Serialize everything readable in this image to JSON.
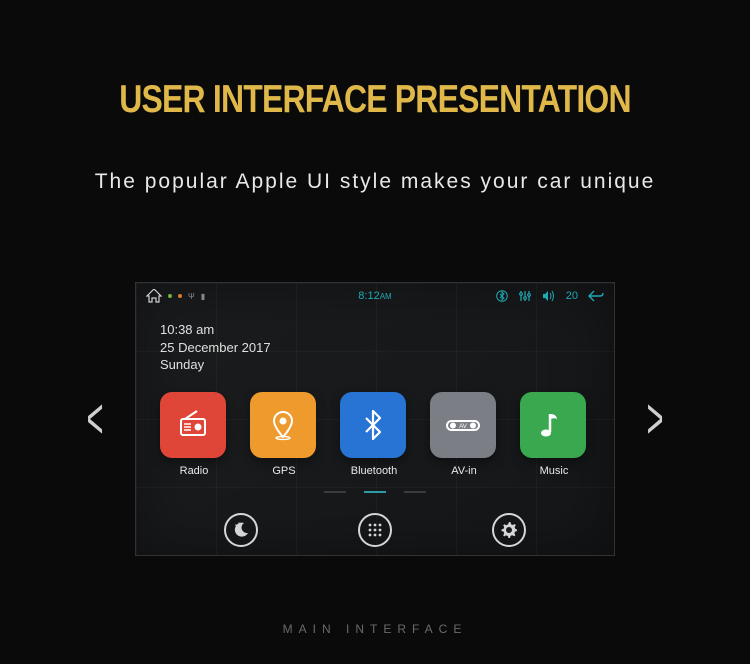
{
  "title": "USER INTERFACE PRESENTATION",
  "subtitle": "The popular Apple UI style makes your car unique",
  "footer": "MAIN INTERFACE",
  "arrows": {
    "prev": "<",
    "next": ">"
  },
  "status": {
    "time": "8:12",
    "ampm": "AM",
    "volume": "20"
  },
  "datetime": {
    "time": "10:38 am",
    "date": "25 December 2017",
    "day": "Sunday"
  },
  "apps": [
    {
      "label": "Radio",
      "color": "c-red",
      "icon": "radio-icon"
    },
    {
      "label": "GPS",
      "color": "c-org",
      "icon": "pin-icon"
    },
    {
      "label": "Bluetooth",
      "color": "c-blu",
      "icon": "bluetooth-icon"
    },
    {
      "label": "AV-in",
      "color": "c-gry",
      "icon": "avin-icon"
    },
    {
      "label": "Music",
      "color": "c-grn",
      "icon": "music-icon"
    }
  ],
  "page_index": 1,
  "page_count": 3
}
